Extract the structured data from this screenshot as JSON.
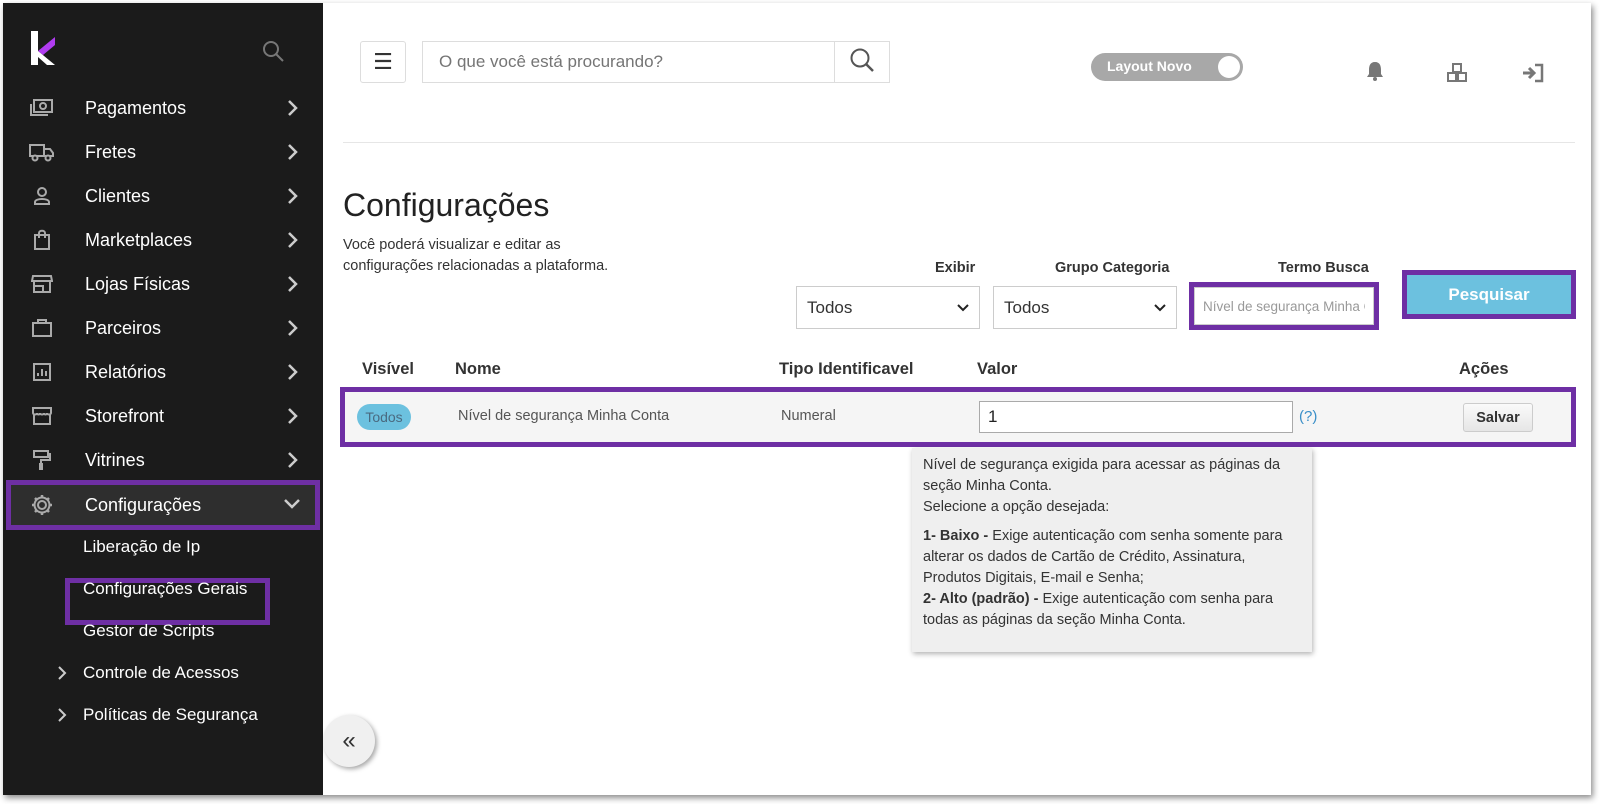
{
  "sidebar": {
    "items": [
      {
        "label": "Pagamentos",
        "icon": "money-icon"
      },
      {
        "label": "Fretes",
        "icon": "truck-icon"
      },
      {
        "label": "Clientes",
        "icon": "user-icon"
      },
      {
        "label": "Marketplaces",
        "icon": "shopping-bag-icon"
      },
      {
        "label": "Lojas Físicas",
        "icon": "store-icon"
      },
      {
        "label": "Parceiros",
        "icon": "briefcase-icon"
      },
      {
        "label": "Relatórios",
        "icon": "report-icon"
      },
      {
        "label": "Storefront",
        "icon": "storefront-icon"
      },
      {
        "label": "Vitrines",
        "icon": "paint-roller-icon"
      },
      {
        "label": "Configurações",
        "icon": "gear-icon"
      }
    ],
    "sub_items": [
      {
        "label": "Liberação de Ip"
      },
      {
        "label": "Configurações Gerais"
      },
      {
        "label": "Gestor de Scripts"
      },
      {
        "label": "Controle de Acessos"
      },
      {
        "label": "Políticas de Segurança"
      }
    ],
    "collapse_label": "«"
  },
  "header": {
    "search_placeholder": "O que você está procurando?",
    "toggle_label": "Layout Novo"
  },
  "page": {
    "title": "Configurações",
    "description": "Você poderá visualizar e editar as configurações relacionadas a plataforma."
  },
  "filters": {
    "exibir_label": "Exibir",
    "exibir_value": "Todos",
    "grupo_label": "Grupo Categoria",
    "grupo_value": "Todos",
    "termo_label": "Termo Busca",
    "termo_value": "Nível de segurança Minha Conta",
    "search_button": "Pesquisar"
  },
  "table": {
    "headers": [
      "Visível",
      "Nome",
      "Tipo Identificavel",
      "Valor",
      "Ações"
    ],
    "rows": [
      {
        "visible": "Todos",
        "name": "Nível de segurança Minha Conta",
        "type": "Numeral",
        "value": "1",
        "help": "(?)",
        "action": "Salvar"
      }
    ]
  },
  "tooltip": {
    "intro": "Nível de segurança exigida para acessar as páginas da seção Minha Conta.",
    "select": "Selecione a opção desejada:",
    "opt1_title": "1- Baixo -",
    "opt1_text": " Exige autenticação com senha somente para alterar os dados de Cartão de Crédito, Assinatura, Produtos Digitais, E-mail e Senha;",
    "opt2_title": "2- Alto (padrão) -",
    "opt2_text": " Exige autenticação com senha para todas as páginas da seção Minha Conta."
  },
  "colors": {
    "sidebar_bg": "#1b1b1b",
    "highlight": "#6e2fa4",
    "accent": "#6cc1df"
  }
}
